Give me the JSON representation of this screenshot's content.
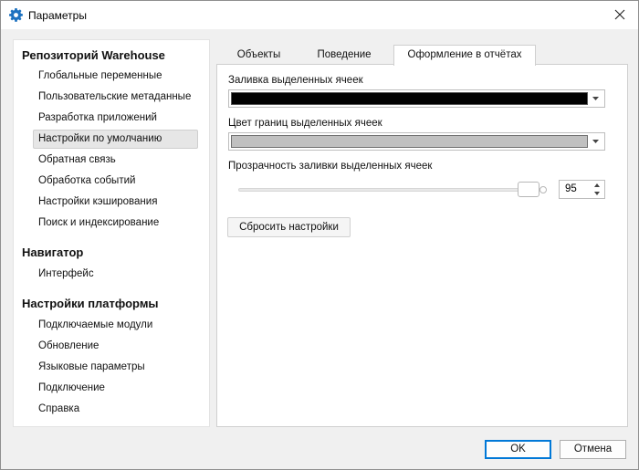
{
  "window": {
    "title": "Параметры"
  },
  "sidebar": {
    "groups": [
      {
        "title": "Репозиторий Warehouse",
        "items": [
          {
            "label": "Глобальные переменные"
          },
          {
            "label": "Пользовательские метаданные"
          },
          {
            "label": "Разработка приложений"
          },
          {
            "label": "Настройки по умолчанию",
            "selected": true
          },
          {
            "label": "Обратная связь"
          },
          {
            "label": "Обработка событий"
          },
          {
            "label": "Настройки кэширования"
          },
          {
            "label": "Поиск и индексирование"
          }
        ]
      },
      {
        "title": "Навигатор",
        "items": [
          {
            "label": "Интерфейс"
          }
        ]
      },
      {
        "title": "Настройки платформы",
        "items": [
          {
            "label": "Подключаемые модули"
          },
          {
            "label": "Обновление"
          },
          {
            "label": "Языковые параметры"
          },
          {
            "label": "Подключение"
          },
          {
            "label": "Справка"
          }
        ]
      }
    ]
  },
  "tabs": [
    {
      "label": "Объекты"
    },
    {
      "label": "Поведение"
    },
    {
      "label": "Оформление в отчётах",
      "active": true
    }
  ],
  "panel": {
    "fill_label": "Заливка выделенных ячеек",
    "fill_color": "#000000",
    "border_label": "Цвет границ выделенных ячеек",
    "border_color": "#c0c0c0",
    "transparency_label": "Прозрачность заливки выделенных ячеек",
    "transparency_value": "95",
    "reset_label": "Сбросить настройки"
  },
  "footer": {
    "ok_label": "OK",
    "cancel_label": "Отмена"
  },
  "colors": {
    "accent": "#0078d7",
    "icon": "#1e72c0"
  }
}
